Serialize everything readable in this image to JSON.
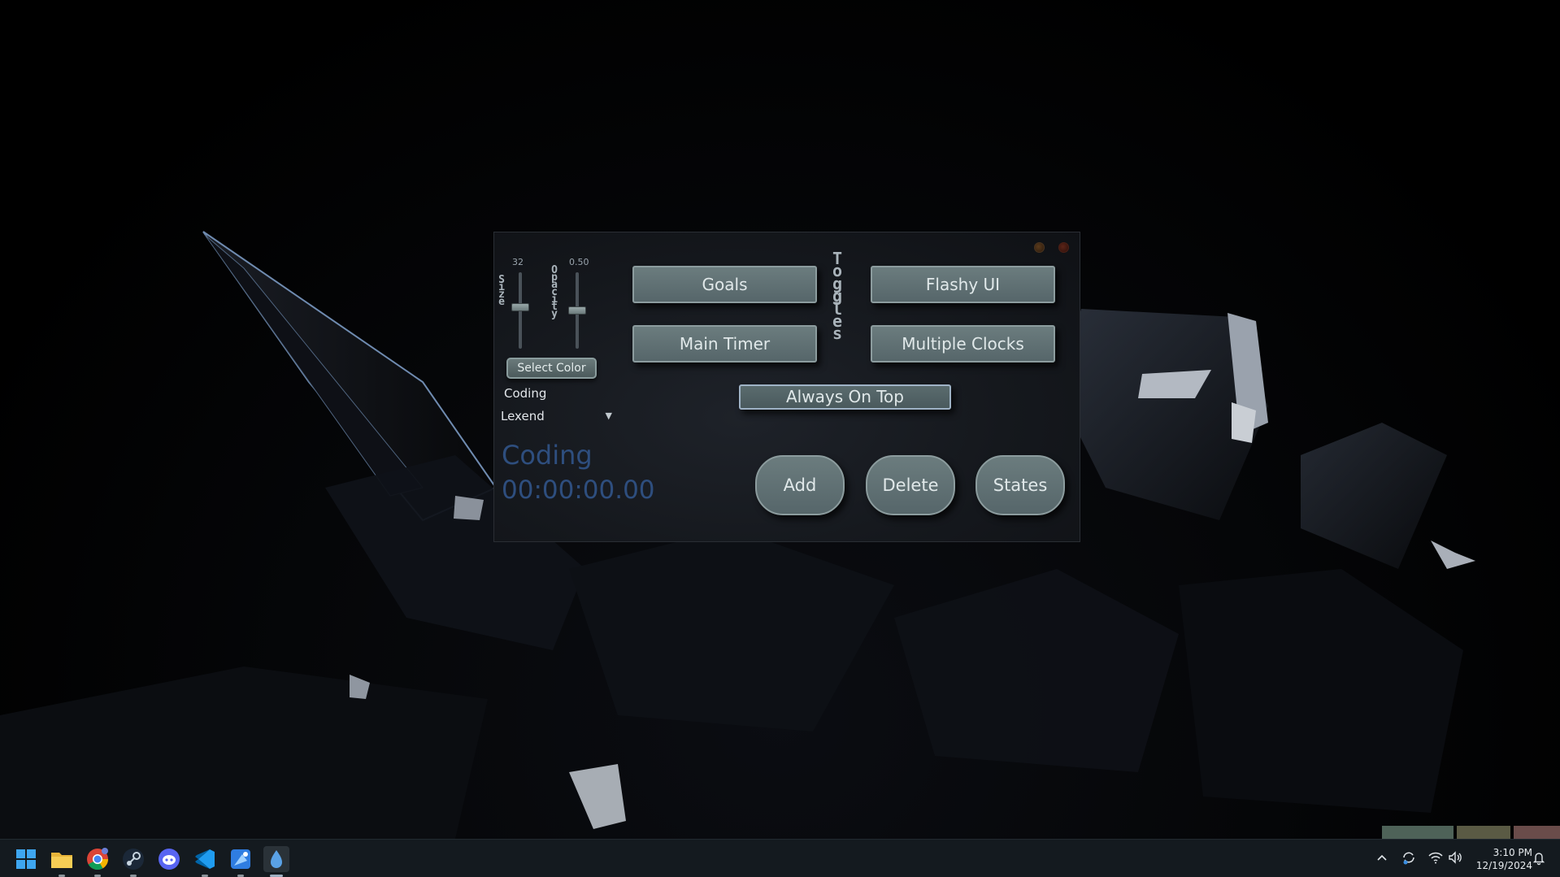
{
  "app": {
    "size_value": "32",
    "size_label": "Size",
    "size_level": 0.55,
    "opacity_value": "0.50",
    "opacity_label": "Opacity",
    "opacity_level": 0.5,
    "select_color_label": "Select Color",
    "category_text": "Coding",
    "font_name": "Lexend",
    "toggles_label": "Toggles",
    "buttons": {
      "goals": "Goals",
      "flashy_ui": "Flashy UI",
      "main_timer": "Main Timer",
      "multiple_clocks": "Multiple Clocks",
      "always_on_top": "Always On Top",
      "add": "Add",
      "delete": "Delete",
      "states": "States"
    },
    "timer": {
      "category": "Coding",
      "time": "00:00:00.00",
      "color": "#2e4e7e"
    }
  },
  "taskbar": {
    "icons": [
      "windows-start-icon",
      "file-explorer-icon",
      "chrome-icon",
      "steam-icon",
      "discord-icon",
      "vscode-icon",
      "paint-app-icon",
      "timer-app-icon"
    ],
    "time": "3:10 PM",
    "date": "12/19/2024"
  }
}
